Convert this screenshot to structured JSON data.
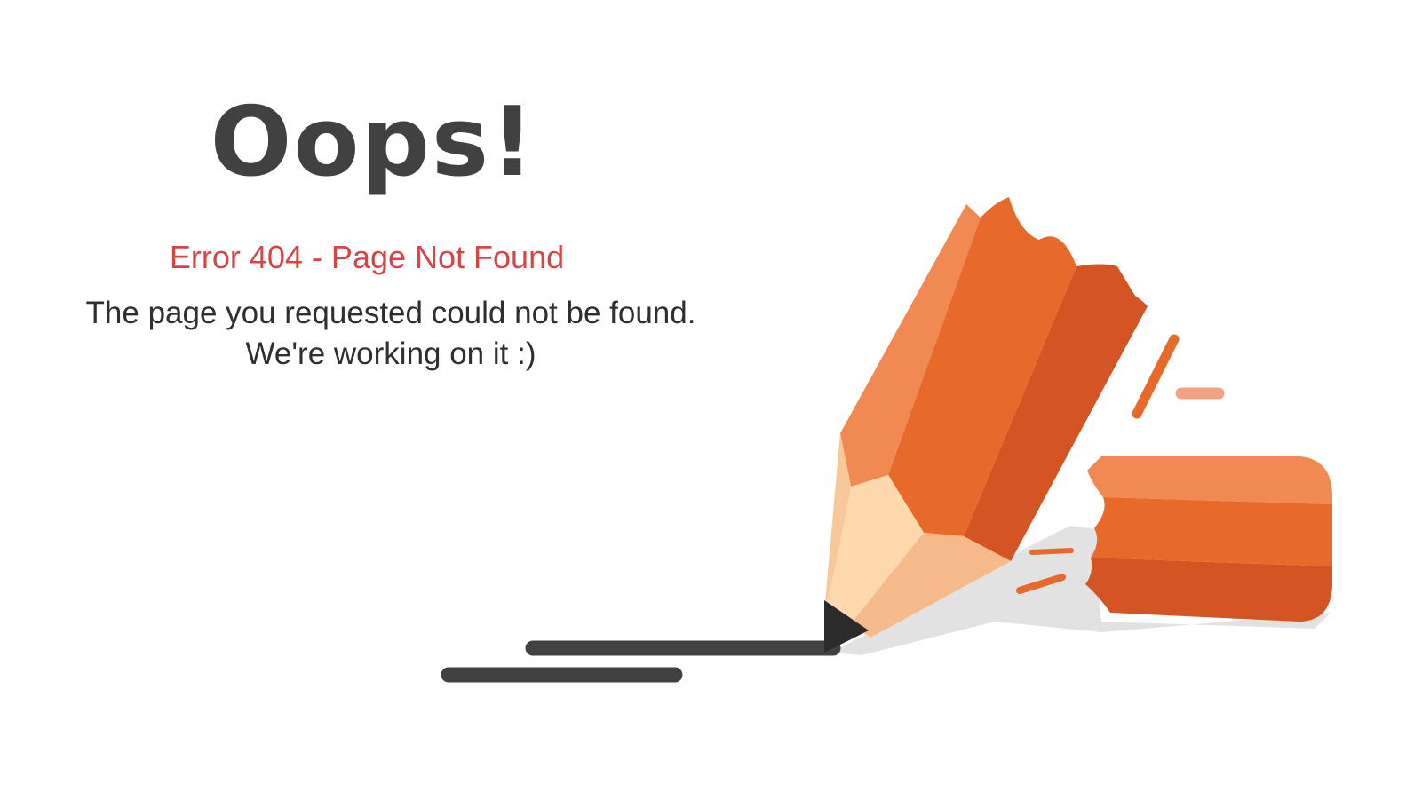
{
  "error_page": {
    "headline": "Oops!",
    "error_code": "Error 404 - Page Not Found",
    "message_line1": "The page you requested could not be found.",
    "message_line2": "We're working on it :)"
  },
  "illustration": {
    "subject": "broken-pencil",
    "colors": {
      "pencil_light": "#f08a52",
      "pencil_mid": "#e86a2a",
      "pencil_dark": "#d45423",
      "wood_light": "#fdd9ad",
      "wood_shade": "#f5b98a",
      "graphite": "#2b2b2b",
      "line": "#414141",
      "shadow": "#e2e2e2",
      "accent_light": "#f2a283"
    }
  },
  "colors": {
    "headline": "#414141",
    "error_text": "#d64545",
    "body_text": "#2f2f2f",
    "background": "#ffffff"
  }
}
